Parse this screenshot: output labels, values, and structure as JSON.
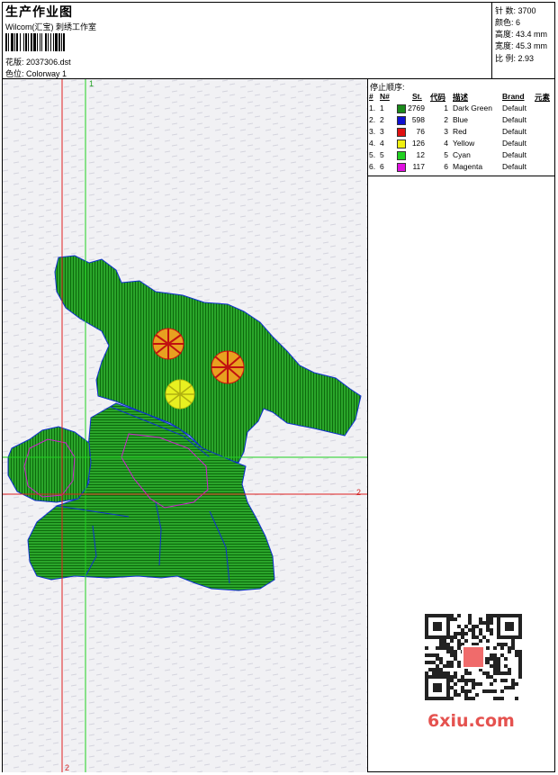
{
  "header": {
    "title": "生产作业图",
    "studio": "Wilcom(汇宝) 刺绣工作室",
    "design_label": "花版:",
    "design_file": "2037306.dst",
    "colorway_label": "色位:",
    "colorway": "Colorway 1"
  },
  "summary": {
    "stitches": "针 数: 3700",
    "colors": "颜色: 6",
    "height": "高度: 43.4 mm",
    "width": "宽度: 45.3 mm",
    "scale": "比 例: 2.93"
  },
  "stop_sequence": {
    "label": "停止顺序:",
    "headers": [
      "#",
      "N#",
      "St.",
      "代码",
      "描述",
      "Brand",
      "元素"
    ],
    "rows": [
      {
        "seq": "1.",
        "n": "1",
        "color": "#1a8a1a",
        "st": "2769",
        "code": "1",
        "desc": "Dark Green",
        "brand": "Default"
      },
      {
        "seq": "2.",
        "n": "2",
        "color": "#1010d0",
        "st": "598",
        "code": "2",
        "desc": "Blue",
        "brand": "Default"
      },
      {
        "seq": "3.",
        "n": "3",
        "color": "#e01010",
        "st": "76",
        "code": "3",
        "desc": "Red",
        "brand": "Default"
      },
      {
        "seq": "4.",
        "n": "4",
        "color": "#f0f010",
        "st": "126",
        "code": "4",
        "desc": "Yellow",
        "brand": "Default"
      },
      {
        "seq": "5.",
        "n": "5",
        "color": "#20d020",
        "st": "12",
        "code": "5",
        "desc": "Cyan",
        "brand": "Default"
      },
      {
        "seq": "6.",
        "n": "6",
        "color": "#e010e0",
        "st": "117",
        "code": "6",
        "desc": "Magenta",
        "brand": "Default"
      }
    ]
  },
  "guides": {
    "v_green": "1",
    "h_red_right": "2",
    "v_red_bottom": "2"
  },
  "watermark": "6xiu.com",
  "colors": {
    "guide_red": "#e02020",
    "guide_green": "#20d020",
    "fill_green": "#1c9a1c",
    "outline_blue": "#1030d0"
  }
}
